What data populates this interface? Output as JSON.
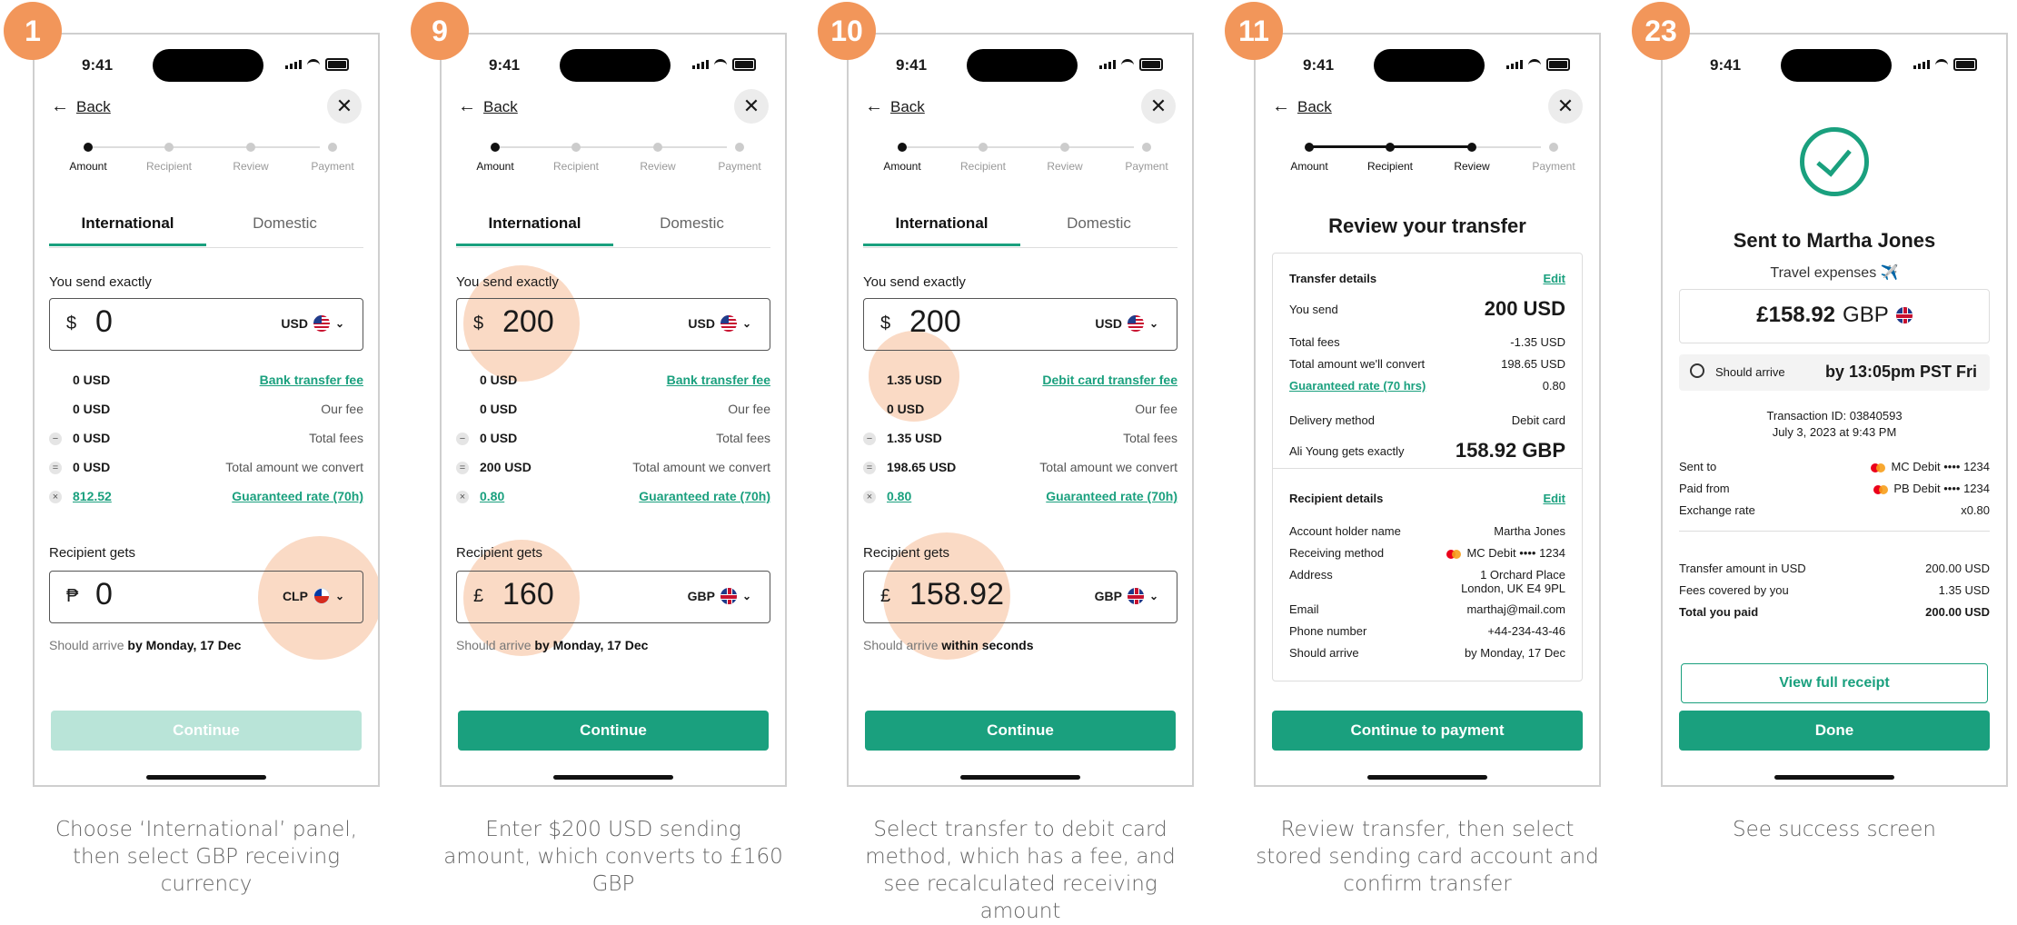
{
  "status": {
    "time": "9:41"
  },
  "common": {
    "back": "Back",
    "progress": [
      "Amount",
      "Recipient",
      "Review",
      "Payment"
    ],
    "tabs": [
      "International",
      "Domestic"
    ],
    "you_send": "You send exactly",
    "recipient_gets": "Recipient gets",
    "should_arrive": "Should arrive",
    "our_fee": "Our fee",
    "total_fees": "Total fees",
    "total_convert": "Total amount we convert",
    "guaranteed": "Guaranteed rate (70h)",
    "continue": "Continue"
  },
  "steps": [
    {
      "badge": "1",
      "caption": "Choose ‘International’ panel, then select GBP receiving currency",
      "send": {
        "symbol": "$",
        "value": "0",
        "currency": "USD"
      },
      "fee_method": "Bank transfer fee",
      "fees": [
        "0 USD",
        "0 USD",
        "0 USD",
        "0 USD"
      ],
      "rate": "812.52",
      "recv": {
        "symbol": "₱",
        "value": "0",
        "currency": "CLP"
      },
      "arrive": "by Monday, 17 Dec"
    },
    {
      "badge": "9",
      "caption": "Enter $200 USD sending amount, which converts to £160 GBP",
      "send": {
        "symbol": "$",
        "value": "200",
        "currency": "USD"
      },
      "fee_method": "Bank transfer fee",
      "fees": [
        "0 USD",
        "0 USD",
        "0 USD",
        "200 USD"
      ],
      "rate": "0.80",
      "recv": {
        "symbol": "£",
        "value": "160",
        "currency": "GBP"
      },
      "arrive": "by Monday, 17 Dec"
    },
    {
      "badge": "10",
      "caption": "Select transfer to debit card method, which has a fee, and see recalculated receiving amount",
      "send": {
        "symbol": "$",
        "value": "200",
        "currency": "USD"
      },
      "fee_method": "Debit card transfer fee",
      "fees": [
        "1.35 USD",
        "0 USD",
        "1.35 USD",
        "198.65 USD"
      ],
      "rate": "0.80",
      "recv": {
        "symbol": "£",
        "value": "158.92",
        "currency": "GBP"
      },
      "arrive": "within seconds"
    }
  ],
  "review": {
    "badge": "11",
    "caption": "Review transfer, then select stored sending card account and confirm transfer",
    "title": "Review your transfer",
    "transfer_details": "Transfer details",
    "edit": "Edit",
    "rows": [
      {
        "k": "You send",
        "v": "200 USD"
      },
      {
        "k": "Total fees",
        "v": "-1.35 USD"
      },
      {
        "k": "Total amount we'll convert",
        "v": "198.65 USD"
      },
      {
        "k": "Guaranteed rate (70 hrs)",
        "v": "0.80"
      },
      {
        "k": "Delivery method",
        "v": "Debit card"
      },
      {
        "k": "Ali Young gets exactly",
        "v": "158.92 GBP"
      }
    ],
    "recipient_details": "Recipient details",
    "rrows": [
      {
        "k": "Account holder name",
        "v": "Martha Jones"
      },
      {
        "k": "Receiving method",
        "v": "MC Debit •••• 1234"
      },
      {
        "k": "Address",
        "v": "1 Orchard Place",
        "v2": "London, UK E4 9PL"
      },
      {
        "k": "Email",
        "v": "marthaj@mail.com"
      },
      {
        "k": "Phone number",
        "v": "+44-234-43-46"
      },
      {
        "k": "Should arrive",
        "v": "by Monday, 17 Dec"
      }
    ],
    "cta": "Continue to payment"
  },
  "success": {
    "badge": "23",
    "caption": "See success screen",
    "title": "Sent to Martha Jones",
    "subtitle": "Travel expenses ✈️",
    "amount": "£158.92",
    "currency": "GBP",
    "should_arrive": "Should arrive",
    "arrive_value": "by 13:05pm PST Fri",
    "transaction": "Transaction ID: 03840593",
    "date": "July 3, 2023 at 9:43 PM",
    "rows": [
      {
        "k": "Sent to",
        "v": "MC Debit •••• 1234"
      },
      {
        "k": "Paid from",
        "v": "PB Debit •••• 1234"
      },
      {
        "k": "Exchange rate",
        "v": "x0.80"
      }
    ],
    "rows2": [
      {
        "k": "Transfer amount in USD",
        "v": "200.00 USD"
      },
      {
        "k": "Fees covered by you",
        "v": "1.35 USD"
      },
      {
        "k": "Total you paid",
        "v": "200.00 USD"
      }
    ],
    "receipt": "View full receipt",
    "done": "Done"
  },
  "colors": {
    "accent": "#1aa07e",
    "badge": "#f2965a",
    "highlight": "rgba(242,150,90,0.35)"
  }
}
